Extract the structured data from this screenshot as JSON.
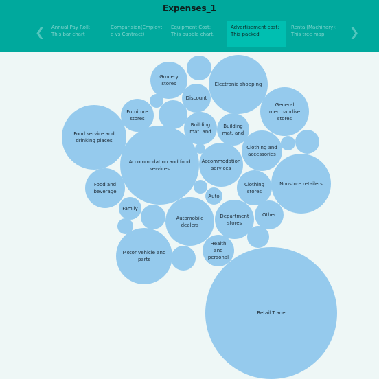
{
  "header": {
    "title": "Expenses_1",
    "tabs": [
      {
        "label": "Annual Pay Roll: This bar chart"
      },
      {
        "label": "Comparision(Employe e vs Contract)"
      },
      {
        "label": "Equipment Cost: This bubble chart."
      },
      {
        "label": "Advertisement cost: This packed"
      },
      {
        "label": "Rental(Machinary): This tree map"
      }
    ],
    "active_tab_index": 3,
    "prev_icon": "chevron-left-icon",
    "next_icon": "chevron-right-icon"
  },
  "bubbles": [
    {
      "label": "Grocery stores"
    },
    {
      "label": ""
    },
    {
      "label": "Electronic shopping"
    },
    {
      "label": "Discount"
    },
    {
      "label": "General merchandise stores"
    },
    {
      "label": ""
    },
    {
      "label": "Furniture stores"
    },
    {
      "label": ""
    },
    {
      "label": "Food service and drinking places"
    },
    {
      "label": "Building mat. and"
    },
    {
      "label": "Building mat. and"
    },
    {
      "label": ""
    },
    {
      "label": ""
    },
    {
      "label": "Clothing and accessories"
    },
    {
      "label": "Accommodation and food services"
    },
    {
      "label": ""
    },
    {
      "label": "Accommodation services"
    },
    {
      "label": "Food and beverage"
    },
    {
      "label": "Clothing stores"
    },
    {
      "label": "Nonstore retailers"
    },
    {
      "label": ""
    },
    {
      "label": "Auto"
    },
    {
      "label": "Family"
    },
    {
      "label": ""
    },
    {
      "label": "Automobile dealers"
    },
    {
      "label": "Department stores"
    },
    {
      "label": "Other"
    },
    {
      "label": ""
    },
    {
      "label": ""
    },
    {
      "label": "Motor vehicle and parts"
    },
    {
      "label": "Health and personal"
    },
    {
      "label": ""
    },
    {
      "label": "Retail Trade"
    }
  ]
}
